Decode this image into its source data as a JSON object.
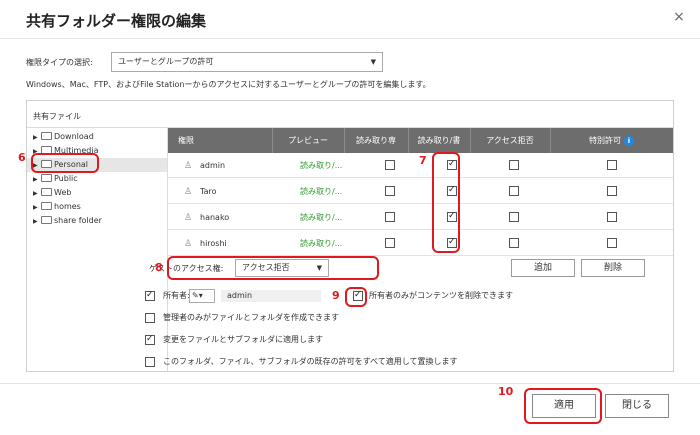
{
  "dialog": {
    "title": "共有フォルダー権限の編集",
    "close_icon": "×"
  },
  "permission_type": {
    "label": "権限タイプの選択:",
    "selected": "ユーザーとグループの許可",
    "description": "Windows、Mac、FTP、およびFile Stationーからのアクセスに対するユーザーとグループの許可を編集します。"
  },
  "shared_files": {
    "title": "共有ファイル",
    "folders": [
      "Download",
      "Multimedia",
      "Personal",
      "Public",
      "Web",
      "homes",
      "share folder"
    ],
    "selected_folder": "Personal"
  },
  "permissions_table": {
    "headers": [
      "権限",
      "プレビュー",
      "読み取り専",
      "読み取り/書",
      "アクセス拒否",
      "特別許可"
    ],
    "info_icon": "i",
    "rows": [
      {
        "user": "admin",
        "preview": "読み取り/...",
        "ro": false,
        "rw": true,
        "deny": false,
        "special": false
      },
      {
        "user": "Taro",
        "preview": "読み取り/...",
        "ro": false,
        "rw": true,
        "deny": false,
        "special": false
      },
      {
        "user": "hanako",
        "preview": "読み取り/...",
        "ro": false,
        "rw": true,
        "deny": false,
        "special": false
      },
      {
        "user": "hiroshi",
        "preview": "読み取り/...",
        "ro": false,
        "rw": true,
        "deny": false,
        "special": false
      }
    ]
  },
  "guest": {
    "label": "ゲストのアクセス権:",
    "selected": "アクセス拒否",
    "add_label": "追加",
    "delete_label": "削除"
  },
  "owner": {
    "label": "所有者:",
    "name": "admin",
    "owner_only_delete": "所有者のみがコンテンツを削除できます"
  },
  "options": {
    "admin_only_create": "管理者のみがファイルとフォルダを作成できます",
    "apply_to_files": "変更をファイルとサブフォルダに適用します",
    "apply_overwrite": "このフォルダ、ファイル、サブフォルダの既存の許可をすべて適用して置換します"
  },
  "footer": {
    "apply_label": "適用",
    "close_label": "閉じる"
  },
  "annotations": {
    "n6": "6",
    "n7": "7",
    "n8": "8",
    "n9": "9",
    "n10": "10",
    "color": "#e0191e"
  }
}
